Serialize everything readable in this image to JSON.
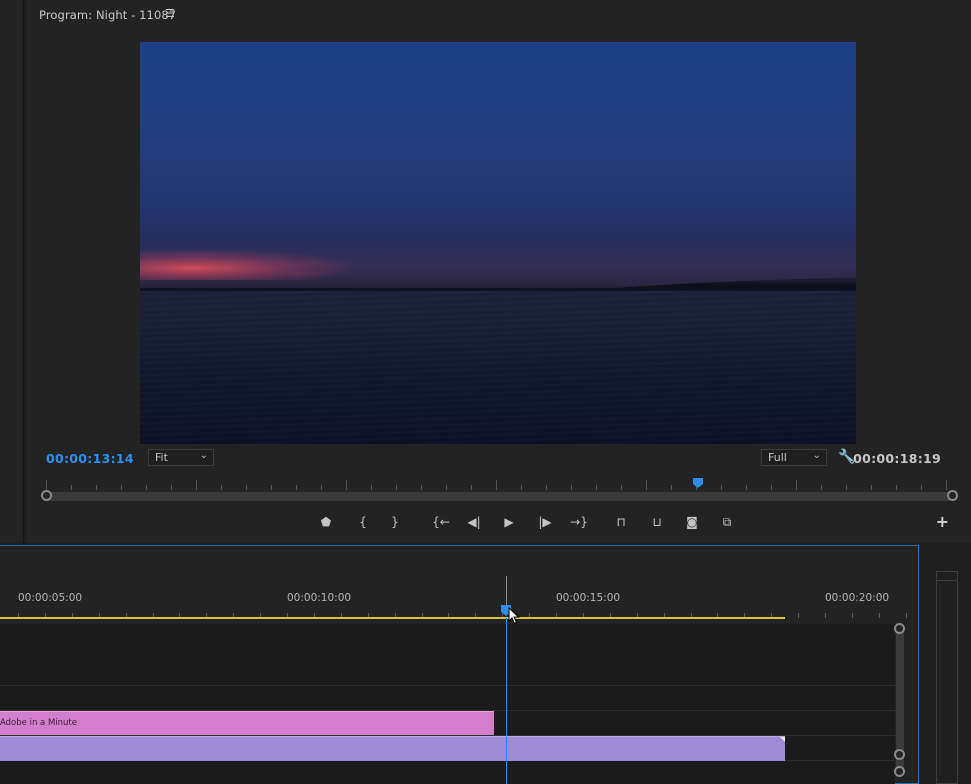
{
  "program_monitor": {
    "title": "Program: Night - 11087",
    "menu_icon": "hamburger-icon",
    "current_timecode": "00:00:13:14",
    "duration_timecode": "00:00:18:19",
    "zoom_select": "Fit",
    "resolution_select": "Full",
    "settings_icon": "wrench-icon",
    "transport": [
      {
        "name": "add-marker-button",
        "icon": "marker-icon",
        "glyph": "⬟"
      },
      {
        "name": "mark-in-button",
        "icon": "mark-in-icon",
        "glyph": "{"
      },
      {
        "name": "mark-out-button",
        "icon": "mark-out-icon",
        "glyph": "}"
      },
      {
        "name": "go-to-in-button",
        "icon": "go-to-in-icon",
        "glyph": "{←"
      },
      {
        "name": "step-back-button",
        "icon": "step-back-icon",
        "glyph": "◀|"
      },
      {
        "name": "play-button",
        "icon": "play-icon",
        "glyph": "▶"
      },
      {
        "name": "step-forward-button",
        "icon": "step-forward-icon",
        "glyph": "|▶"
      },
      {
        "name": "go-to-out-button",
        "icon": "go-to-out-icon",
        "glyph": "→}"
      },
      {
        "name": "lift-button",
        "icon": "lift-icon",
        "glyph": "⊓"
      },
      {
        "name": "extract-button",
        "icon": "extract-icon",
        "glyph": "⊔"
      },
      {
        "name": "export-frame-button",
        "icon": "camera-icon",
        "glyph": "◙"
      },
      {
        "name": "comparison-view-button",
        "icon": "comparison-icon",
        "glyph": "⧉"
      }
    ],
    "add_icon": "+"
  },
  "timeline": {
    "ruler_labels": [
      "00:00:05:00",
      "00:00:10:00",
      "00:00:15:00",
      "00:00:20:00"
    ],
    "clips": [
      {
        "name": "Adobe in a Minute",
        "label": "Adobe in a Minute",
        "color": "#d27fcb"
      },
      {
        "name": "video-clip",
        "label": "",
        "color": "#9f8bd3"
      }
    ],
    "playhead_color": "#2d8cf0",
    "work_area_color": "#d8c43a"
  }
}
